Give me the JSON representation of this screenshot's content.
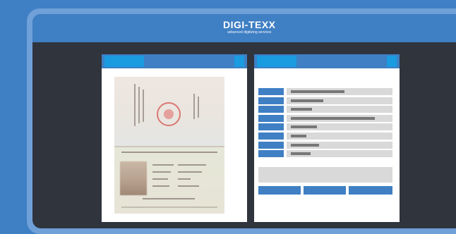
{
  "brand": {
    "name": "DIGI-TEXX",
    "tagline": "advanced digitizing services",
    "colors": {
      "primary": "#3f7fc4",
      "accent": "#1b9be0",
      "dark": "#2f343d"
    }
  },
  "left_panel": {
    "title_icon": "tab-indicator",
    "content": "scanned-passport-image"
  },
  "right_panel": {
    "fields": [
      {
        "label": "",
        "value_fill": 0.55
      },
      {
        "label": "",
        "value_fill": 0.33
      },
      {
        "label": "",
        "value_fill": 0.22
      },
      {
        "label": "",
        "value_fill": 0.86
      },
      {
        "label": "",
        "value_fill": 0.27
      },
      {
        "label": "",
        "value_fill": 0.16
      },
      {
        "label": "",
        "value_fill": 0.29
      },
      {
        "label": "",
        "value_fill": 0.2
      }
    ],
    "buttons": [
      "",
      "",
      ""
    ]
  }
}
